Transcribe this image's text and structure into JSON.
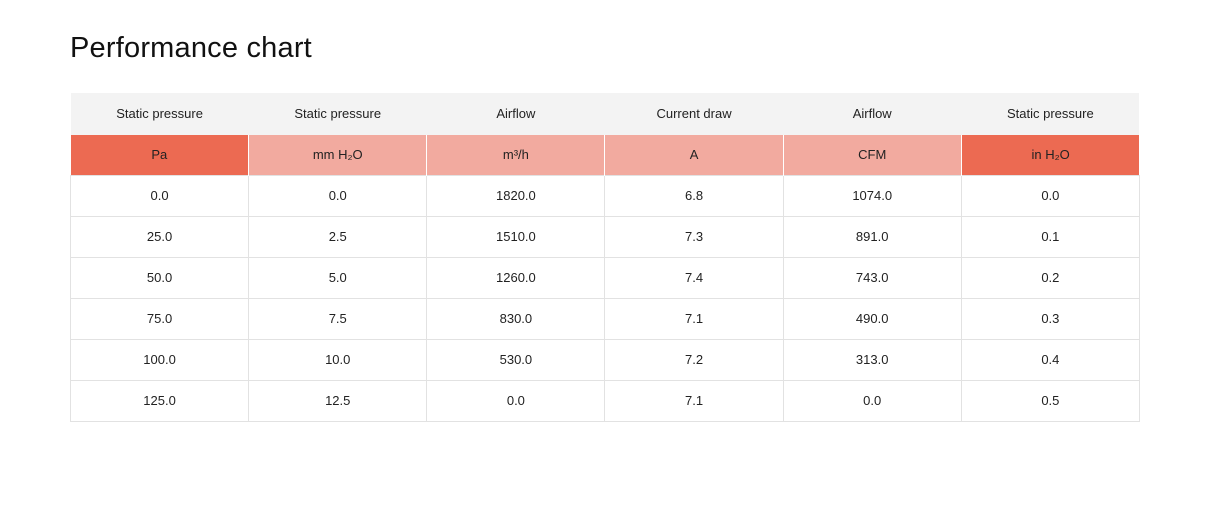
{
  "title": "Performance chart",
  "table": {
    "headers": [
      "Static pressure",
      "Static pressure",
      "Airflow",
      "Current draw",
      "Airflow",
      "Static pressure"
    ],
    "units": [
      "Pa",
      "mm H₂O",
      "m³/h",
      "A",
      "CFM",
      "in H₂O"
    ],
    "unit_colors": {
      "strong": "#ec6a52",
      "light": "#f2aa9f",
      "header_bg": "#f3f3f3"
    },
    "rows": [
      [
        "0.0",
        "0.0",
        "1820.0",
        "6.8",
        "1074.0",
        "0.0"
      ],
      [
        "25.0",
        "2.5",
        "1510.0",
        "7.3",
        "891.0",
        "0.1"
      ],
      [
        "50.0",
        "5.0",
        "1260.0",
        "7.4",
        "743.0",
        "0.2"
      ],
      [
        "75.0",
        "7.5",
        "830.0",
        "7.1",
        "490.0",
        "0.3"
      ],
      [
        "100.0",
        "10.0",
        "530.0",
        "7.2",
        "313.0",
        "0.4"
      ],
      [
        "125.0",
        "12.5",
        "0.0",
        "7.1",
        "0.0",
        "0.5"
      ]
    ]
  }
}
